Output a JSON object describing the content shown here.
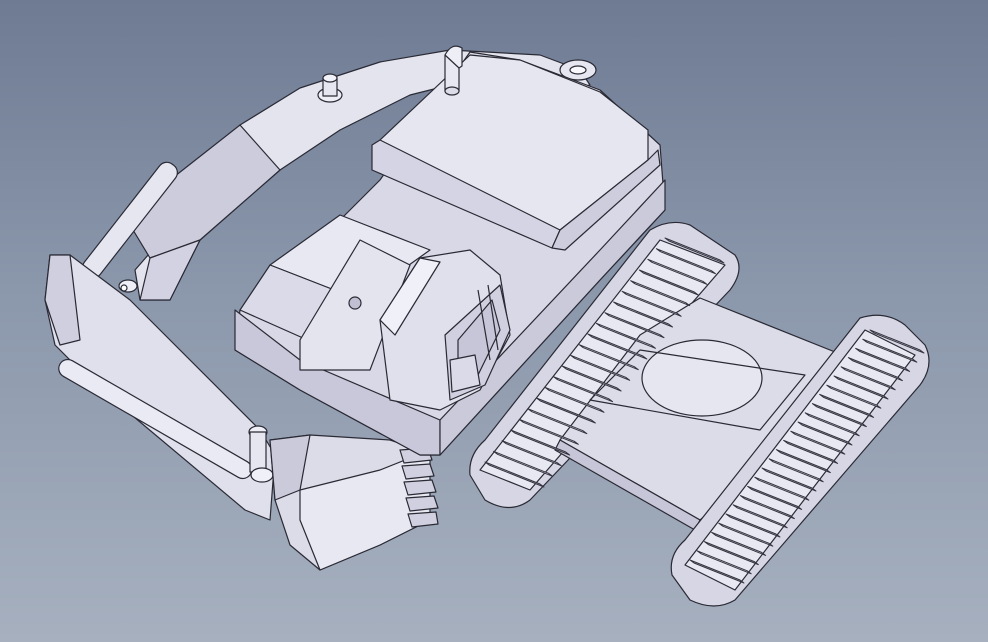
{
  "viewport": {
    "background_top": "#6f7b93",
    "background_bottom": "#a6b0bf"
  },
  "model": {
    "part_fill": "#dcdce8",
    "part_fill_light": "#ececf4",
    "part_fill_dark": "#c4c4d6",
    "edge_color": "#2a2a35",
    "track_link_count_near": 26,
    "track_link_count_far": 22
  }
}
